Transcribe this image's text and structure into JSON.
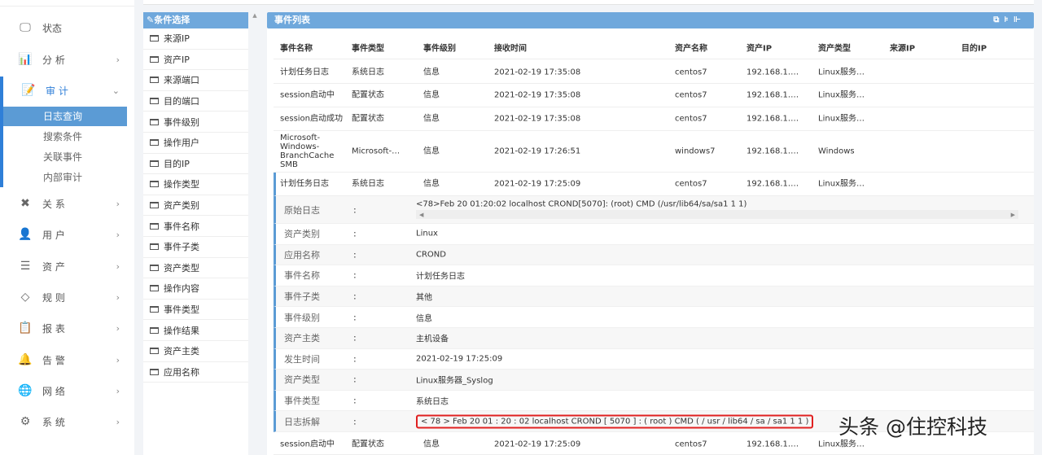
{
  "sidebar": {
    "items": [
      {
        "label": "状态",
        "icon": "monitor-icon",
        "y": 0
      },
      {
        "label": "分 析",
        "icon": "bar-chart-icon"
      },
      {
        "label": "审 计",
        "icon": "audit-icon"
      },
      {
        "label": "关 系",
        "icon": "relation-icon"
      },
      {
        "label": "用 户",
        "icon": "user-icon"
      },
      {
        "label": "资 产",
        "icon": "asset-icon"
      },
      {
        "label": "规 则",
        "icon": "rule-icon"
      },
      {
        "label": "报 表",
        "icon": "report-icon"
      },
      {
        "label": "告 警",
        "icon": "alarm-icon"
      },
      {
        "label": "网 络",
        "icon": "globe-icon"
      },
      {
        "label": "系 统",
        "icon": "settings-icon"
      }
    ],
    "audit_sub": [
      "日志查询",
      "搜索条件",
      "关联事件",
      "内部审计"
    ],
    "selected": "日志查询"
  },
  "conditions": {
    "title": "条件选择",
    "items": [
      "来源IP",
      "资产IP",
      "来源端口",
      "目的端口",
      "事件级别",
      "操作用户",
      "目的IP",
      "操作类型",
      "资产类别",
      "事件名称",
      "事件子类",
      "资产类型",
      "操作内容",
      "事件类型",
      "操作结果",
      "资产主类",
      "应用名称"
    ]
  },
  "events": {
    "title": "事件列表",
    "columns": [
      "事件名称",
      "事件类型",
      "事件级别",
      "接收时间",
      "资产名称",
      "资产IP",
      "资产类型",
      "来源IP",
      "目的IP"
    ],
    "rows": [
      [
        "计划任务日志",
        "系统日志",
        "信息",
        "2021-02-19 17:35:08",
        "centos7",
        "192.168.1.…",
        "Linux服务…",
        "",
        ""
      ],
      [
        "session启动中",
        "配置状态",
        "信息",
        "2021-02-19 17:35:08",
        "centos7",
        "192.168.1.…",
        "Linux服务…",
        "",
        ""
      ],
      [
        "session启动成功",
        "配置状态",
        "信息",
        "2021-02-19 17:35:08",
        "centos7",
        "192.168.1.…",
        "Linux服务…",
        "",
        ""
      ],
      [
        "Microsoft-Windows-BranchCache SMB",
        "Microsoft-…",
        "信息",
        "2021-02-19 17:26:51",
        "windows7",
        "192.168.1.…",
        "Windows",
        "",
        ""
      ],
      [
        "计划任务日志",
        "系统日志",
        "信息",
        "2021-02-19 17:25:09",
        "centos7",
        "192.168.1.…",
        "Linux服务…",
        "",
        ""
      ]
    ],
    "detail": [
      {
        "k": "原始日志",
        "v": "<78>Feb 20 01:20:02 localhost CROND[5070]: (root) CMD (/usr/lib64/sa/sa1 1 1)"
      },
      {
        "k": "资产类别",
        "v": "Linux"
      },
      {
        "k": "应用名称",
        "v": "CROND"
      },
      {
        "k": "事件名称",
        "v": "计划任务日志"
      },
      {
        "k": "事件子类",
        "v": "其他"
      },
      {
        "k": "事件级别",
        "v": "信息"
      },
      {
        "k": "资产主类",
        "v": "主机设备"
      },
      {
        "k": "发生时间",
        "v": "2021-02-19 17:25:09"
      },
      {
        "k": "资产类型",
        "v": "Linux服务器_Syslog"
      },
      {
        "k": "事件类型",
        "v": "系统日志"
      },
      {
        "k": "日志拆解",
        "v": "< 78 > Feb  20  01 : 20 : 02  localhost  CROND [ 5070 ] : ( root )  CMD  ( / usr / lib64 / sa / sa1  1  1 )"
      }
    ],
    "colon": ":",
    "last_row": [
      "session启动中",
      "配置状态",
      "信息",
      "2021-02-19 17:25:09",
      "centos7",
      "192.168.1.…",
      "Linux服务…",
      "",
      ""
    ]
  },
  "watermark": "头条 @住控科技",
  "colors": {
    "header_blue": "#6fa8dc",
    "selected": "#5b9bd5",
    "highlight": "#e02020"
  }
}
